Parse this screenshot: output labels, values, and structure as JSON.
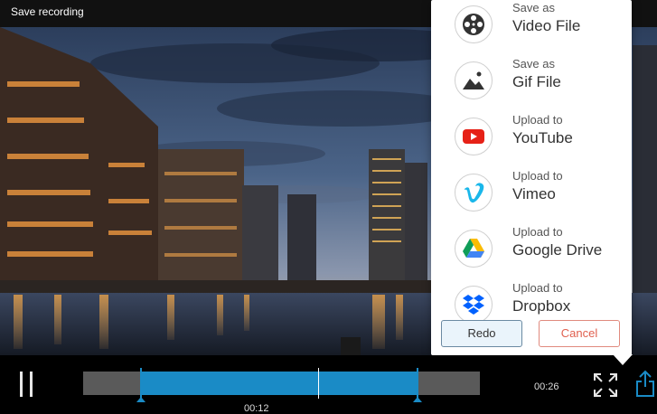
{
  "window": {
    "title": "Save recording"
  },
  "share_menu": {
    "options": [
      {
        "id": "video",
        "small": "Save as",
        "big": "Video File",
        "icon": "film-reel-icon"
      },
      {
        "id": "gif",
        "small": "Save as",
        "big": "Gif File",
        "icon": "image-landscape-icon"
      },
      {
        "id": "youtube",
        "small": "Upload to",
        "big": "YouTube",
        "icon": "youtube-icon"
      },
      {
        "id": "vimeo",
        "small": "Upload to",
        "big": "Vimeo",
        "icon": "vimeo-icon"
      },
      {
        "id": "gdrive",
        "small": "Upload to",
        "big": "Google Drive",
        "icon": "google-drive-icon"
      },
      {
        "id": "dropbox",
        "small": "Upload to",
        "big": "Dropbox",
        "icon": "dropbox-icon"
      }
    ],
    "redo_label": "Redo",
    "cancel_label": "Cancel"
  },
  "timeline": {
    "current_time": "00:12",
    "end_time": "00:26"
  },
  "colors": {
    "accent": "#1a8bc6",
    "cancel": "#e0604f",
    "youtube": "#e62117",
    "vimeo": "#1ab7ea",
    "dropbox": "#0061fe"
  }
}
